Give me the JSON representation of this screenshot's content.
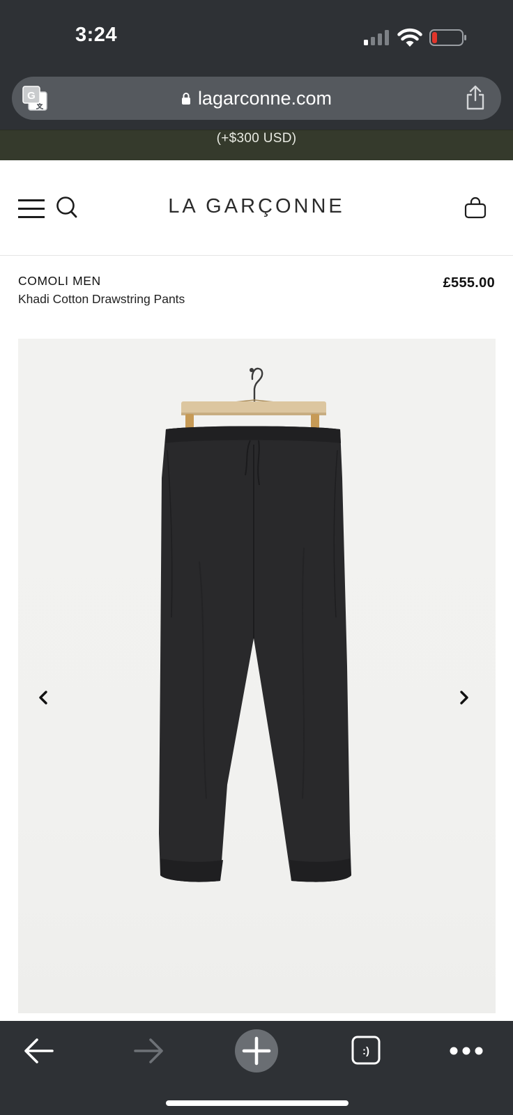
{
  "status_bar": {
    "time": "3:24",
    "signal_icon": "cellular-signal-icon",
    "wifi_icon": "wifi-icon",
    "battery_icon": "battery-low-icon",
    "battery_color": "#e0352b"
  },
  "browser": {
    "url": "lagarconne.com",
    "translate_icon": "translate-icon",
    "lock_icon": "lock-icon",
    "share_icon": "share-icon"
  },
  "promo": {
    "text": "(+$300 USD)",
    "background": "#353a2c"
  },
  "header": {
    "logo": "LA GARÇONNE",
    "menu_icon": "hamburger-menu-icon",
    "search_icon": "search-icon",
    "bag_icon": "shopping-bag-icon"
  },
  "product": {
    "brand": "COMOLI MEN",
    "name": "Khadi Cotton Drawstring Pants",
    "price": "£555.00",
    "image_subject": "black drawstring pants on wooden hanger",
    "prev_icon": "chevron-left-icon",
    "next_icon": "chevron-right-icon"
  },
  "toolbar": {
    "back_icon": "arrow-left-icon",
    "forward_icon": "arrow-right-icon",
    "new_tab_icon": "plus-icon",
    "tabs_icon": "tab-switcher-icon",
    "more_icon": "more-dots-icon"
  }
}
